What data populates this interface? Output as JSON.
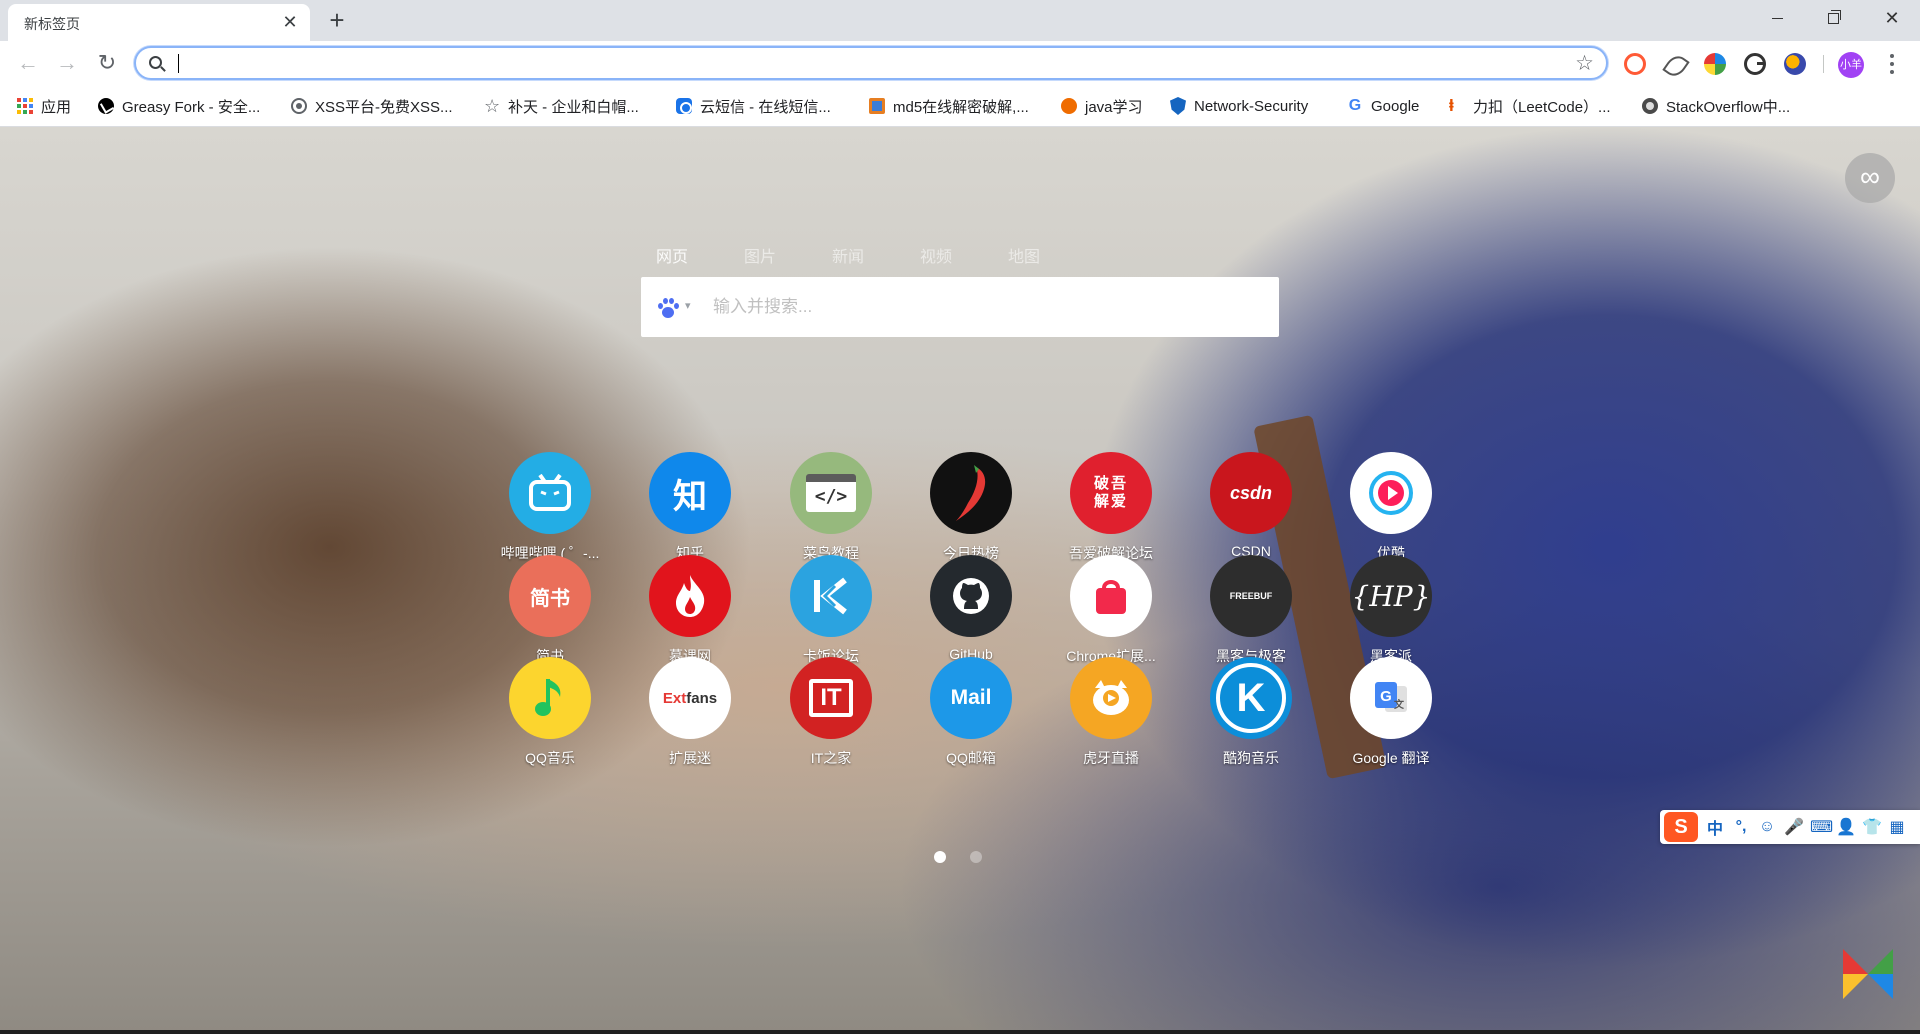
{
  "browser": {
    "tab": {
      "title": "新标签页",
      "close_glyph": "✕"
    },
    "new_tab_glyph": "+",
    "window_controls": {
      "minimize": "minimize-icon",
      "maximize": "restore-icon",
      "close_glyph": "✕"
    },
    "nav": {
      "back_glyph": "←",
      "forward_glyph": "→",
      "reload_glyph": "↻"
    },
    "omnibox": {
      "value": "",
      "star_glyph": "☆"
    },
    "extensions": [
      "infinity-ext-icon",
      "feather-ext-icon",
      "tamper-ext-icon",
      "grammarly-ext-icon",
      "firefox-like-ext-icon"
    ],
    "profile": {
      "label": "小羊",
      "color": "#a142f4"
    },
    "bookmarks": [
      {
        "label": "应用",
        "icon": "apps-grid-icon"
      },
      {
        "label": "Greasy Fork - 安全...",
        "icon": "greasyfork-icon"
      },
      {
        "label": "XSS平台-免费XSS...",
        "icon": "globe-icon"
      },
      {
        "label": "补天 - 企业和白帽...",
        "icon": "star-icon"
      },
      {
        "label": "云短信 - 在线短信...",
        "icon": "sms-icon"
      },
      {
        "label": "md5在线解密破解,...",
        "icon": "md5-icon"
      },
      {
        "label": "java学习",
        "icon": "java-icon"
      },
      {
        "label": "Network-Security",
        "icon": "shield-icon"
      },
      {
        "label": "Google",
        "icon": "google-icon"
      },
      {
        "label": "力扣（LeetCode）...",
        "icon": "leetcode-icon"
      },
      {
        "label": "StackOverflow中...",
        "icon": "globe-icon"
      }
    ]
  },
  "newtab": {
    "infinity_glyph": "∞",
    "search_tabs": [
      {
        "label": "网页",
        "active": true
      },
      {
        "label": "图片",
        "active": false
      },
      {
        "label": "新闻",
        "active": false
      },
      {
        "label": "视频",
        "active": false
      },
      {
        "label": "地图",
        "active": false
      }
    ],
    "search": {
      "placeholder": "输入并搜索...",
      "engine_icon": "baidu-paw-icon",
      "caret": "▾"
    },
    "tiles": [
      {
        "label": "哔哩哔哩 ( ゜-...",
        "icon": "bilibili-icon",
        "bg": "#23ade5",
        "glyph": "📺"
      },
      {
        "label": "知乎",
        "icon": "zhihu-icon",
        "bg": "#0f88eb",
        "glyph": "知"
      },
      {
        "label": "菜鸟教程",
        "icon": "runoob-icon",
        "bg": "#96b97d",
        "glyph": "</>"
      },
      {
        "label": "今日热榜",
        "icon": "tophub-icon",
        "bg": "#111111",
        "glyph": "🌶"
      },
      {
        "label": "吾爱破解论坛",
        "icon": "52pojie-icon",
        "bg": "#e0202e",
        "glyph": "破吾解爱"
      },
      {
        "label": "CSDN",
        "icon": "csdn-icon",
        "bg": "#c9161d",
        "glyph": "csdn"
      },
      {
        "label": "优酷",
        "icon": "youku-icon",
        "bg": "#ffffff",
        "glyph": "▶"
      },
      {
        "label": "简书",
        "icon": "jianshu-icon",
        "bg": "#ea6f5a",
        "glyph": "简书"
      },
      {
        "label": "慕课网",
        "icon": "imooc-icon",
        "bg": "#e1141c",
        "glyph": "🔥"
      },
      {
        "label": "卡饭论坛",
        "icon": "kafan-icon",
        "bg": "#2ba3e0",
        "glyph": "K"
      },
      {
        "label": "GitHub",
        "icon": "github-icon",
        "bg": "#24292e",
        "glyph": "◉"
      },
      {
        "label": "Chrome扩展...",
        "icon": "chrome-store-icon",
        "bg": "#ffffff",
        "glyph": "🛍"
      },
      {
        "label": "黑客与极客",
        "icon": "freebuf-icon",
        "bg": "#2d2d2d",
        "glyph": "FREEBUF"
      },
      {
        "label": "黑客派",
        "icon": "hackpai-icon",
        "bg": "#2f2f2f",
        "glyph": "{HP}"
      },
      {
        "label": "QQ音乐",
        "icon": "qqmusic-icon",
        "bg": "#fcd52e",
        "glyph": "♪"
      },
      {
        "label": "扩展迷",
        "icon": "extfans-icon",
        "bg": "#ffffff",
        "glyph": "Extfans"
      },
      {
        "label": "IT之家",
        "icon": "ithome-icon",
        "bg": "#d22222",
        "glyph": "IT"
      },
      {
        "label": "QQ邮箱",
        "icon": "qqmail-icon",
        "bg": "#1d98e8",
        "glyph": "Mail"
      },
      {
        "label": "虎牙直播",
        "icon": "huya-icon",
        "bg": "#f5a623",
        "glyph": "🎥"
      },
      {
        "label": "酷狗音乐",
        "icon": "kugou-icon",
        "bg": "#0c8ed9",
        "glyph": "K"
      },
      {
        "label": "Google 翻译",
        "icon": "google-translate-icon",
        "bg": "#ffffff",
        "glyph": "G"
      }
    ],
    "page_dots": [
      {
        "active": true
      },
      {
        "active": false
      }
    ]
  },
  "ime": {
    "logo": "S",
    "items": [
      "中",
      "°,",
      "☺",
      "🎤",
      "⌨",
      "👤",
      "👕",
      "▦"
    ]
  }
}
